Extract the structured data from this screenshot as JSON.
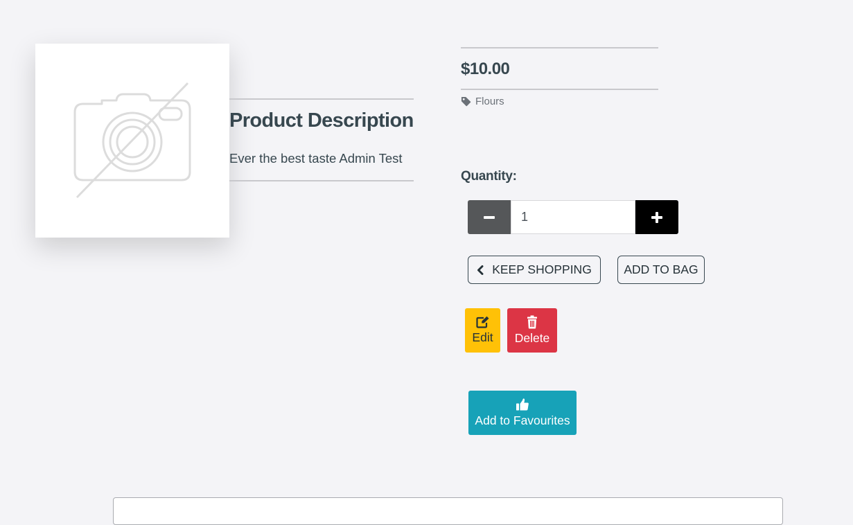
{
  "product": {
    "image": {
      "alt_icon": "no-image-camera-icon"
    },
    "price": "$10.00",
    "category": {
      "icon": "tag-icon",
      "label": "Flours"
    },
    "description": {
      "title": "Product Description",
      "text": "Ever the best taste Admin Test"
    }
  },
  "quantity": {
    "label": "Quantity:",
    "value": "1",
    "decrement_icon": "minus-icon",
    "increment_icon": "plus-icon"
  },
  "actions": {
    "keep_shopping": {
      "label": "KEEP SHOPPING",
      "icon": "chevron-left-icon"
    },
    "add_to_bag": {
      "label": "ADD TO BAG"
    },
    "edit": {
      "label": "Edit",
      "icon": "edit-icon",
      "color": "#ffc107"
    },
    "delete": {
      "label": "Delete",
      "icon": "trash-icon",
      "color": "#dc3545"
    },
    "add_to_favourites": {
      "label": "Add to Favourites",
      "icon": "thumbs-up-icon",
      "color": "#17a2b8"
    }
  },
  "colors": {
    "background": "#f4f4f7",
    "text": "#37474f",
    "qty_minus": "#555759",
    "qty_plus": "#000000"
  }
}
